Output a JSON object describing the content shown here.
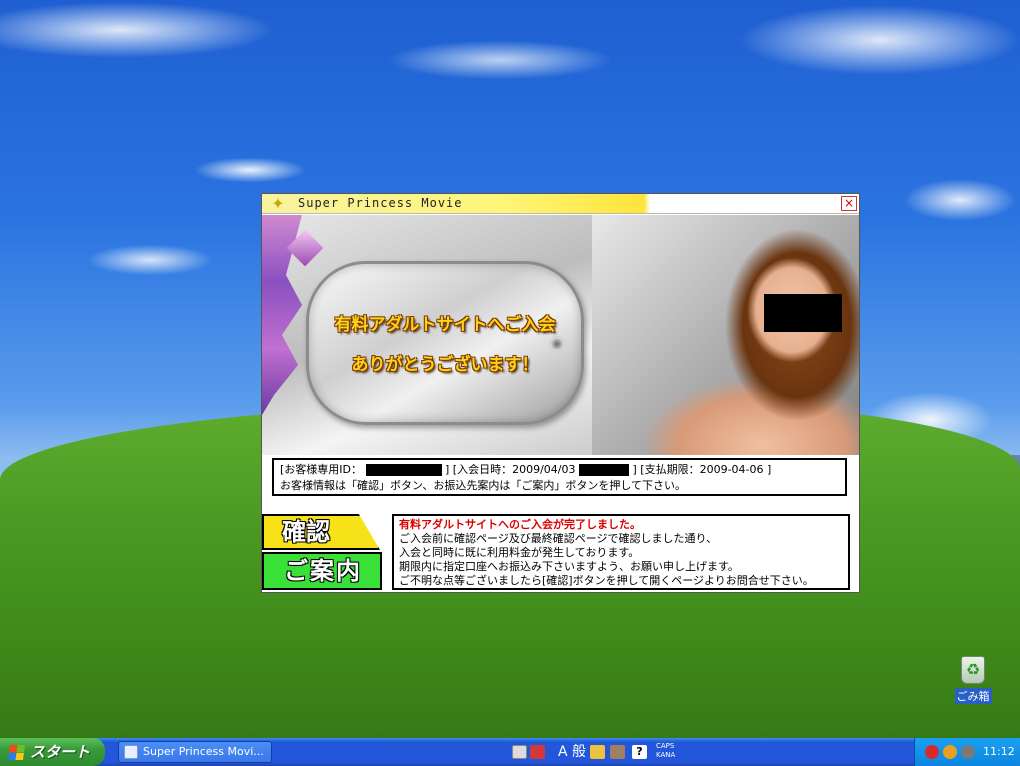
{
  "dialog": {
    "title": "Super Princess Movie",
    "close_label": "×",
    "banner": {
      "line1": "有料アダルトサイトへご入会",
      "line2": "ありがとうございます！"
    },
    "info": {
      "id_label": "[お客様専用ID：",
      "join_label": "] [入会日時：2009/04/03",
      "deadline": "] [支払期限：2009-04-06 ]",
      "line2": "お客様情報は「確認」ボタン、お振込先案内は「ご案内」ボタンを押して下さい。"
    },
    "buttons": {
      "confirm": "確認",
      "guide": "ご案内"
    },
    "message": {
      "heading": "有料アダルトサイトへのご入会が完了しました。",
      "lines": [
        "ご入会前に確認ページ及び最終確認ページで確認しました通り、",
        "入会と同時に既に利用料金が発生しております。",
        "期限内に指定口座へお振込み下さいますよう、お願い申し上げます。",
        "ご不明な点等ございましたら[確認]ボタンを押して開くページよりお問合せ下さい。"
      ]
    }
  },
  "desktop": {
    "recycle_bin_label": "ごみ箱"
  },
  "taskbar": {
    "start_label": "スタート",
    "task_item_label": "Super Princess Movi...",
    "ime_mode": "A 般",
    "ime_help": "?",
    "caps_label": "CAPS",
    "kana_label": "KANA",
    "clock": "11:12"
  },
  "colors": {
    "titlebar_accent": "#ffe43a",
    "confirm_button": "#f7e21a",
    "guide_button": "#38e038",
    "message_heading": "#dd0000",
    "taskbar": "#2456dc",
    "start_button": "#3a9a3a"
  }
}
